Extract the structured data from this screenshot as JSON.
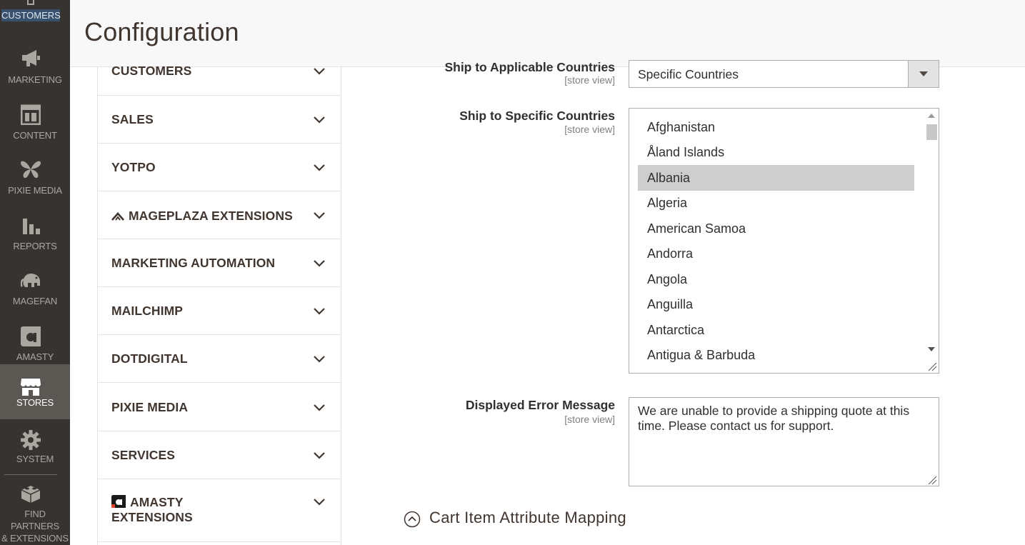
{
  "nav": {
    "top_label": "CUSTOMERS",
    "items": [
      {
        "label": "MARKETING",
        "icon": "megaphone-icon"
      },
      {
        "label": "CONTENT",
        "icon": "layout-icon"
      },
      {
        "label": "PIXIE MEDIA",
        "icon": "butterfly-icon"
      },
      {
        "label": "REPORTS",
        "icon": "bar-chart-icon"
      },
      {
        "label": "MAGEFAN",
        "icon": "elephant-icon"
      },
      {
        "label": "AMASTY",
        "icon": "amasty-icon"
      },
      {
        "label": "STORES",
        "icon": "store-icon"
      },
      {
        "label": "SYSTEM",
        "icon": "gear-icon"
      },
      {
        "label_line1": "FIND PARTNERS",
        "label_line2": "& EXTENSIONS",
        "icon": "lego-block-icon"
      }
    ]
  },
  "header": {
    "title": "Configuration"
  },
  "tabs": [
    {
      "label": "CUSTOMERS"
    },
    {
      "label": "SALES"
    },
    {
      "label": "YOTPO"
    },
    {
      "label": "MAGEPLAZA EXTENSIONS"
    },
    {
      "label": "MARKETING AUTOMATION"
    },
    {
      "label": "MAILCHIMP"
    },
    {
      "label": "DOTDIGITAL"
    },
    {
      "label": "PIXIE MEDIA"
    },
    {
      "label": "SERVICES"
    },
    {
      "label_line1": "AMASTY",
      "label_line2": "EXTENSIONS"
    }
  ],
  "form": {
    "applicable": {
      "label": "Ship to Applicable Countries",
      "scope": "[store view]",
      "value": "Specific Countries"
    },
    "specific": {
      "label": "Ship to Specific Countries",
      "scope": "[store view]",
      "options": [
        "Afghanistan",
        "Åland Islands",
        "Albania",
        "Algeria",
        "American Samoa",
        "Andorra",
        "Angola",
        "Anguilla",
        "Antarctica",
        "Antigua & Barbuda"
      ],
      "selected": "Albania"
    },
    "error": {
      "label": "Displayed Error Message",
      "scope": "[store view]",
      "value": "We are unable to provide a shipping quote at this time. Please contact us for support."
    },
    "section_title": "Cart Item Attribute Mapping"
  },
  "colors": {
    "nav_bg": "#373330",
    "nav_active": "#5b5752",
    "selected_option": "#cecece"
  }
}
